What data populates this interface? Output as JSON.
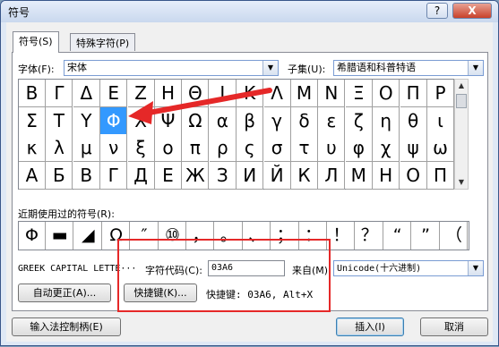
{
  "window": {
    "title": "符号",
    "help_glyph": "?",
    "close_glyph": "X"
  },
  "tabs": [
    {
      "label": "符号(S)"
    },
    {
      "label": "特殊字符(P)"
    }
  ],
  "font": {
    "label": "字体(F):",
    "value": "宋体"
  },
  "subset": {
    "label": "子集(U):",
    "value": "希腊语和科普特语"
  },
  "symbol_rows": [
    [
      "Β",
      "Γ",
      "Δ",
      "Ε",
      "Ζ",
      "Η",
      "Θ",
      "Ι",
      "Κ",
      "Λ",
      "Μ",
      "Ν",
      "Ξ",
      "Ο",
      "Π",
      "Ρ"
    ],
    [
      "Σ",
      "Τ",
      "Υ",
      "Φ",
      "Χ",
      "Ψ",
      "Ω",
      "α",
      "β",
      "γ",
      "δ",
      "ε",
      "ζ",
      "η",
      "θ",
      "ι"
    ],
    [
      "κ",
      "λ",
      "μ",
      "ν",
      "ξ",
      "ο",
      "π",
      "ρ",
      "ς",
      "σ",
      "τ",
      "υ",
      "φ",
      "χ",
      "ψ",
      "ω"
    ],
    [
      "А",
      "Б",
      "В",
      "Г",
      "Д",
      "Е",
      "Ж",
      "З",
      "И",
      "Й",
      "К",
      "Л",
      "М",
      "Н",
      "О",
      "П"
    ]
  ],
  "selected_symbol": "Φ",
  "recent": {
    "label": "近期使用过的符号(R):",
    "symbols": [
      "Φ",
      "▬",
      "◢",
      "Ω",
      "″",
      "⑩",
      "，",
      "。",
      "、",
      "；",
      "：",
      "！",
      "？",
      "“",
      "”",
      "（"
    ]
  },
  "char_name": "GREEK CAPITAL LETTE···",
  "char_code": {
    "label": "字符代码(C):",
    "value": "03A6"
  },
  "from": {
    "label": "来自(M):",
    "value": "Unicode(十六进制)"
  },
  "buttons": {
    "autocorrect": "自动更正(A)...",
    "shortcut_key": "快捷键(K)...",
    "ime": "输入法控制柄(E)",
    "insert": "插入(I)",
    "cancel": "取消"
  },
  "shortcut_text": "快捷键: 03A6, Alt+X",
  "colors": {
    "annotation": "#e52828",
    "selected": "#3399ff"
  }
}
